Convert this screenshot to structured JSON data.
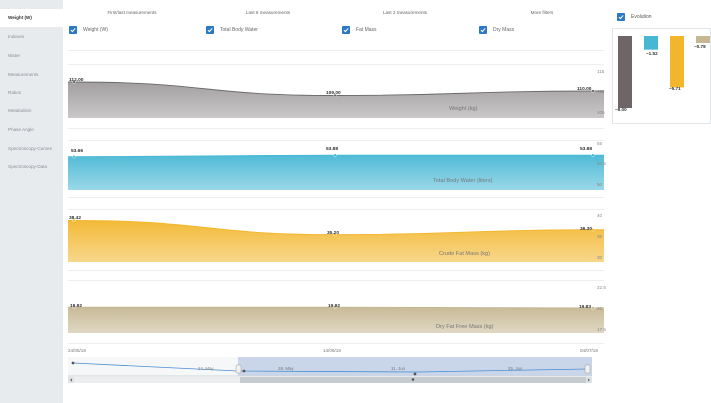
{
  "sidebar": {
    "items": [
      {
        "label": "Weight (W)",
        "active": true
      },
      {
        "label": "Indexes"
      },
      {
        "label": "Water"
      },
      {
        "label": "Measurements"
      },
      {
        "label": "Ratios"
      },
      {
        "label": "Metabolism"
      },
      {
        "label": "Phase Angle"
      },
      {
        "label": "Spectroscopy-Curves"
      },
      {
        "label": "Spectroscopy-Data"
      }
    ]
  },
  "filters": [
    "First/last measurements",
    "Last 6 measurements",
    "Last 2 measurements",
    "More filters"
  ],
  "checkboxes": [
    "Weight (W)",
    "Total Body Water",
    "Fat Mass",
    "Dry Mass"
  ],
  "evolution": {
    "label": "Evolution",
    "bars": [
      {
        "name": "weight",
        "value": -8.0,
        "label": "−8.00",
        "color": "#6f6566"
      },
      {
        "name": "water",
        "value": -1.52,
        "label": "−1.52",
        "color": "#47b7d4"
      },
      {
        "name": "fat",
        "value": -5.71,
        "label": "−5.71",
        "color": "#f2b62c"
      },
      {
        "name": "dry",
        "value": -0.78,
        "label": "−0.78",
        "color": "#c5b792"
      }
    ]
  },
  "x_labels": [
    "24/05/18",
    "14/06/18",
    "04/07/18"
  ],
  "navigator": {
    "labels": [
      "24. May",
      "28. May",
      "11. Jun",
      "25. Jun"
    ]
  },
  "chart_data": [
    {
      "type": "area",
      "title": "Weight (kg)",
      "x": [
        "24/05/18",
        "14/06/18",
        "04/07/18"
      ],
      "values": [
        112.0,
        109.0,
        110.0
      ],
      "value_labels": [
        "112.00",
        "109.00",
        "110.00"
      ],
      "yticks": [
        "115",
        "110",
        "105"
      ],
      "ylim": [
        104,
        116
      ],
      "color": "#9e9a9b"
    },
    {
      "type": "area",
      "title": "Total Body Water (liters)",
      "x": [
        "24/05/18",
        "14/06/18",
        "04/07/18"
      ],
      "values": [
        53.66,
        53.88,
        53.88
      ],
      "value_labels": [
        "53.66",
        "53.88",
        "53.88"
      ],
      "yticks": [
        "55",
        "52.5",
        "50"
      ],
      "ylim": [
        49,
        56
      ],
      "color": "#47b7d4"
    },
    {
      "type": "area",
      "title": "Crude Fat Mass (kg)",
      "x": [
        "24/05/18",
        "14/06/18",
        "04/07/18"
      ],
      "values": [
        38.42,
        35.2,
        36.3
      ],
      "value_labels": [
        "38.42",
        "35.20",
        "36.30"
      ],
      "yticks": [
        "40",
        "35",
        "30"
      ],
      "ylim": [
        29,
        41
      ],
      "color": "#f2b62c"
    },
    {
      "type": "area",
      "title": "Dry Fat Free Mass (kg)",
      "x": [
        "24/05/18",
        "14/06/18",
        "04/07/18"
      ],
      "values": [
        19.92,
        19.92,
        19.83
      ],
      "value_labels": [
        "19.92",
        "19.92",
        "19.83"
      ],
      "yticks": [
        "22.5",
        "20",
        "17.5"
      ],
      "ylim": [
        17,
        23
      ],
      "color": "#c5b792"
    }
  ]
}
